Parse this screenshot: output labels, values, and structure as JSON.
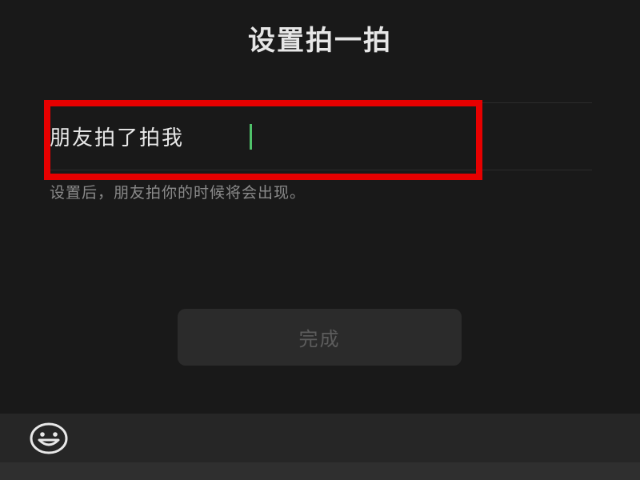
{
  "header": {
    "title": "设置拍一拍"
  },
  "pat_input": {
    "prefix": "朋友拍了拍我",
    "value": "",
    "placeholder": ""
  },
  "hint": {
    "text": "设置后，朋友拍你的时候将会出现。"
  },
  "actions": {
    "done_label": "完成"
  },
  "toolbar": {
    "emoji_icon": "smiley-face-icon"
  },
  "colors": {
    "background": "#191919",
    "cursor": "#4fc26a",
    "highlight": "#e60000",
    "button_bg": "#2b2b2b",
    "button_text": "#5c5c5c"
  }
}
